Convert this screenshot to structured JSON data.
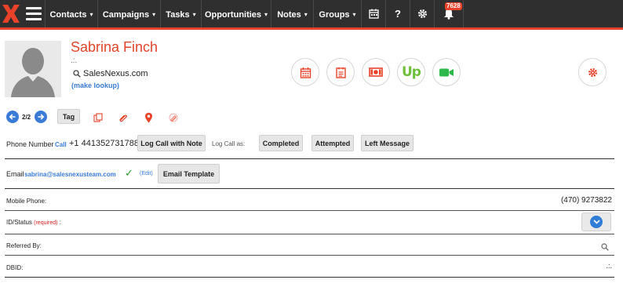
{
  "nav": {
    "items": [
      {
        "label": "Contacts"
      },
      {
        "label": "Campaigns"
      },
      {
        "label": "Tasks"
      },
      {
        "label": "Opportunities"
      },
      {
        "label": "Notes"
      },
      {
        "label": "Groups"
      }
    ],
    "notification_count": "7628"
  },
  "contact": {
    "name": "Sabrina Finch",
    "subline": ".:.",
    "company": "SalesNexus.com",
    "make_lookup": "(make lookup)"
  },
  "record_nav": {
    "position": "2/2",
    "tag_label": "Tag"
  },
  "phone": {
    "label": "Phone Number",
    "call_link": "Call",
    "number": "+1 441352731788",
    "log_call_note": "Log Call with Note",
    "log_call_as": "Log Call as:",
    "completed": "Completed",
    "attempted": "Attempted",
    "left_message": "Left Message"
  },
  "email": {
    "label": "Email",
    "address": "sabrina@salesnexusteam.com",
    "edit": "(Edit)",
    "template_button": "Email Template"
  },
  "fields": {
    "mobile_label": "Mobile Phone:",
    "mobile_value": "(470) 9273822",
    "id_status_label": "ID/Status",
    "required": "(required)",
    "id_status_colon": ":",
    "referred_label": "Referred By:",
    "dbid_label": "DBID:",
    "dbid_value": ".:."
  },
  "colors": {
    "accent": "#e8432a",
    "link": "#3a7bd5",
    "nav_bg": "#2f2f2f",
    "upwork_green": "#6fbf3b"
  }
}
